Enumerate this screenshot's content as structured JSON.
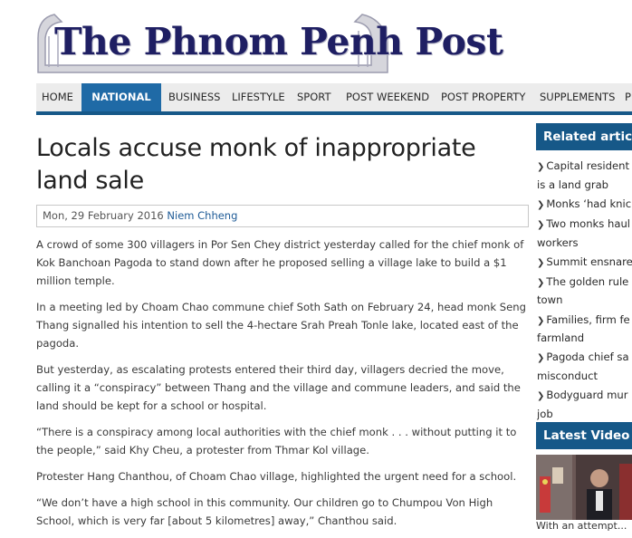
{
  "site": {
    "logo_text": "The Phnom Penh Post"
  },
  "nav": {
    "items": [
      "HOME",
      "NATIONAL",
      "BUSINESS",
      "LIFESTYLE",
      "SPORT",
      "POST WEEKEND",
      "POST PROPERTY",
      "SUPPLEMENTS",
      "P"
    ],
    "active": "NATIONAL",
    "colors": {
      "active_bg": "#1f6aa6",
      "border": "#165888"
    }
  },
  "article": {
    "headline": "Locals accuse monk of inappropriate land sale",
    "date": "Mon, 29 February 2016",
    "author": "Niem Chheng",
    "paragraphs": [
      "A crowd of some 300 villagers in Por Sen Chey district yesterday called for the chief monk of Kok Banchoan Pagoda to stand down after he proposed selling a village lake to build a $1 million temple.",
      "In a meeting led by Choam Chao commune chief Soth Sath on February 24, head monk Seng Thang signalled his intention to sell the 4-hectare Srah Preah Tonle lake, located east of the pagoda.",
      "But yesterday, as escalating protests entered their third day, villagers decried the move, calling it a “conspiracy” between Thang and the village and commune leaders, and said the land should be kept for a school or hospital.",
      "“There is a conspiracy among local authorities with the chief monk . . . without putting it to the people,” said Khy Cheu, a protester from Thmar Kol village.",
      "Protester Hang Chanthou, of Choam Chao village, highlighted the urgent need for a school.",
      "“We don’t have a high school in this community. Our children go to Chumpou Von High School, which is very far [about 5 kilometres] away,” Chanthou said."
    ]
  },
  "sidebar": {
    "related_title": "Related articl",
    "related": [
      {
        "line1": "Capital resident",
        "line2": "is a land grab"
      },
      {
        "line1": "Monks ‘had knic",
        "line2": ""
      },
      {
        "line1": "Two monks haul",
        "line2": "workers"
      },
      {
        "line1": "Summit ensnare",
        "line2": ""
      },
      {
        "line1": "The golden rule",
        "line2": "town"
      },
      {
        "line1": "Families, firm fe",
        "line2": "farmland"
      },
      {
        "line1": "Pagoda chief sa",
        "line2": "misconduct"
      },
      {
        "line1": "Bodyguard mur",
        "line2": "job"
      }
    ],
    "video_title": "Latest Video",
    "video_caption": "With an attempt..."
  }
}
